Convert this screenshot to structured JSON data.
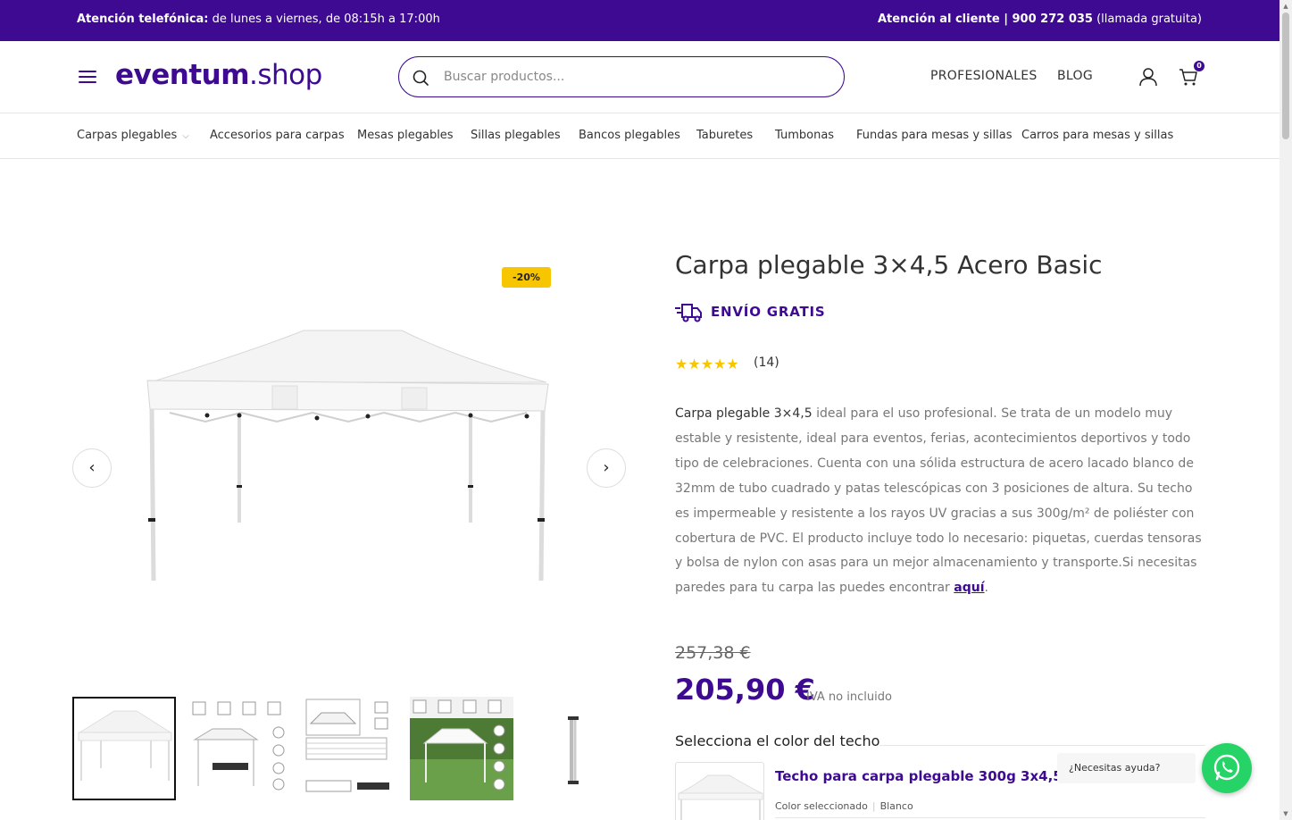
{
  "topbar": {
    "left_bold": "Atención telefónica:",
    "left_text": "de lunes a viernes, de 08:15h a 17:00h",
    "right_bold": "Atención al cliente | 900 272 035",
    "right_text": "(llamada gratuita)"
  },
  "header": {
    "logo_bold": "eventum",
    "logo_light": ".shop",
    "search_placeholder": "Buscar productos...",
    "nav": [
      "PROFESIONALES",
      "BLOG"
    ],
    "cart_count": "0",
    "icons": [
      "menu-icon",
      "search-icon",
      "user-icon",
      "cart-icon"
    ]
  },
  "categories": [
    "Carpas plegables",
    "Accesorios para carpas",
    "Mesas plegables",
    "Sillas plegables",
    "Bancos plegables",
    "Taburetes",
    "Tumbonas",
    "Fundas para mesas y sillas",
    "Carros para mesas y sillas"
  ],
  "gallery": {
    "discount_badge": "-20%",
    "thumbnails": 5,
    "active_thumbnail": 1
  },
  "product": {
    "title": "Carpa plegable 3×4,5 Acero Basic",
    "shipping": "ENVÍO GRATIS",
    "rating": 5,
    "rating_stars": "★★★★★",
    "rating_count": "(14)",
    "description_strong": "Carpa plegable 3×4,5",
    "description_body": " ideal para el uso profesional. Se trata de un modelo muy estable y resistente, ideal para eventos, ferias, acontecimientos deportivos y todo tipo de celebraciones. Cuenta con una sólida estructura de acero lacado blanco de 32mm de tubo cuadrado y patas telescópicas con 3 posiciones de altura. Su techo es impermeable y resistente a los rayos UV gracias a sus 300g/m² de poliéster con cobertura de PVC. El producto incluye todo lo necesario: piquetas, cuerdas tensoras y bolsa de nylon con asas para un mejor almacenamiento y transporte.Si necesitas paredes para tu carpa las puedes encontrar ",
    "description_link": "aquí",
    "description_end": ".",
    "old_price": "257,38 €",
    "price": "205,90 €",
    "tax_note": "IVA no incluido",
    "color_heading": "Selecciona el color del techo",
    "option_title": "Techo para carpa plegable 300g 3x4,5",
    "option_selected_label": "Color seleccionado",
    "option_selected_value": "Blanco"
  },
  "help": {
    "text": "¿Necesitas ayuda?"
  },
  "colors": {
    "brand": "#3d0a91",
    "badge": "#f7c600",
    "whatsapp": "#25d366"
  }
}
